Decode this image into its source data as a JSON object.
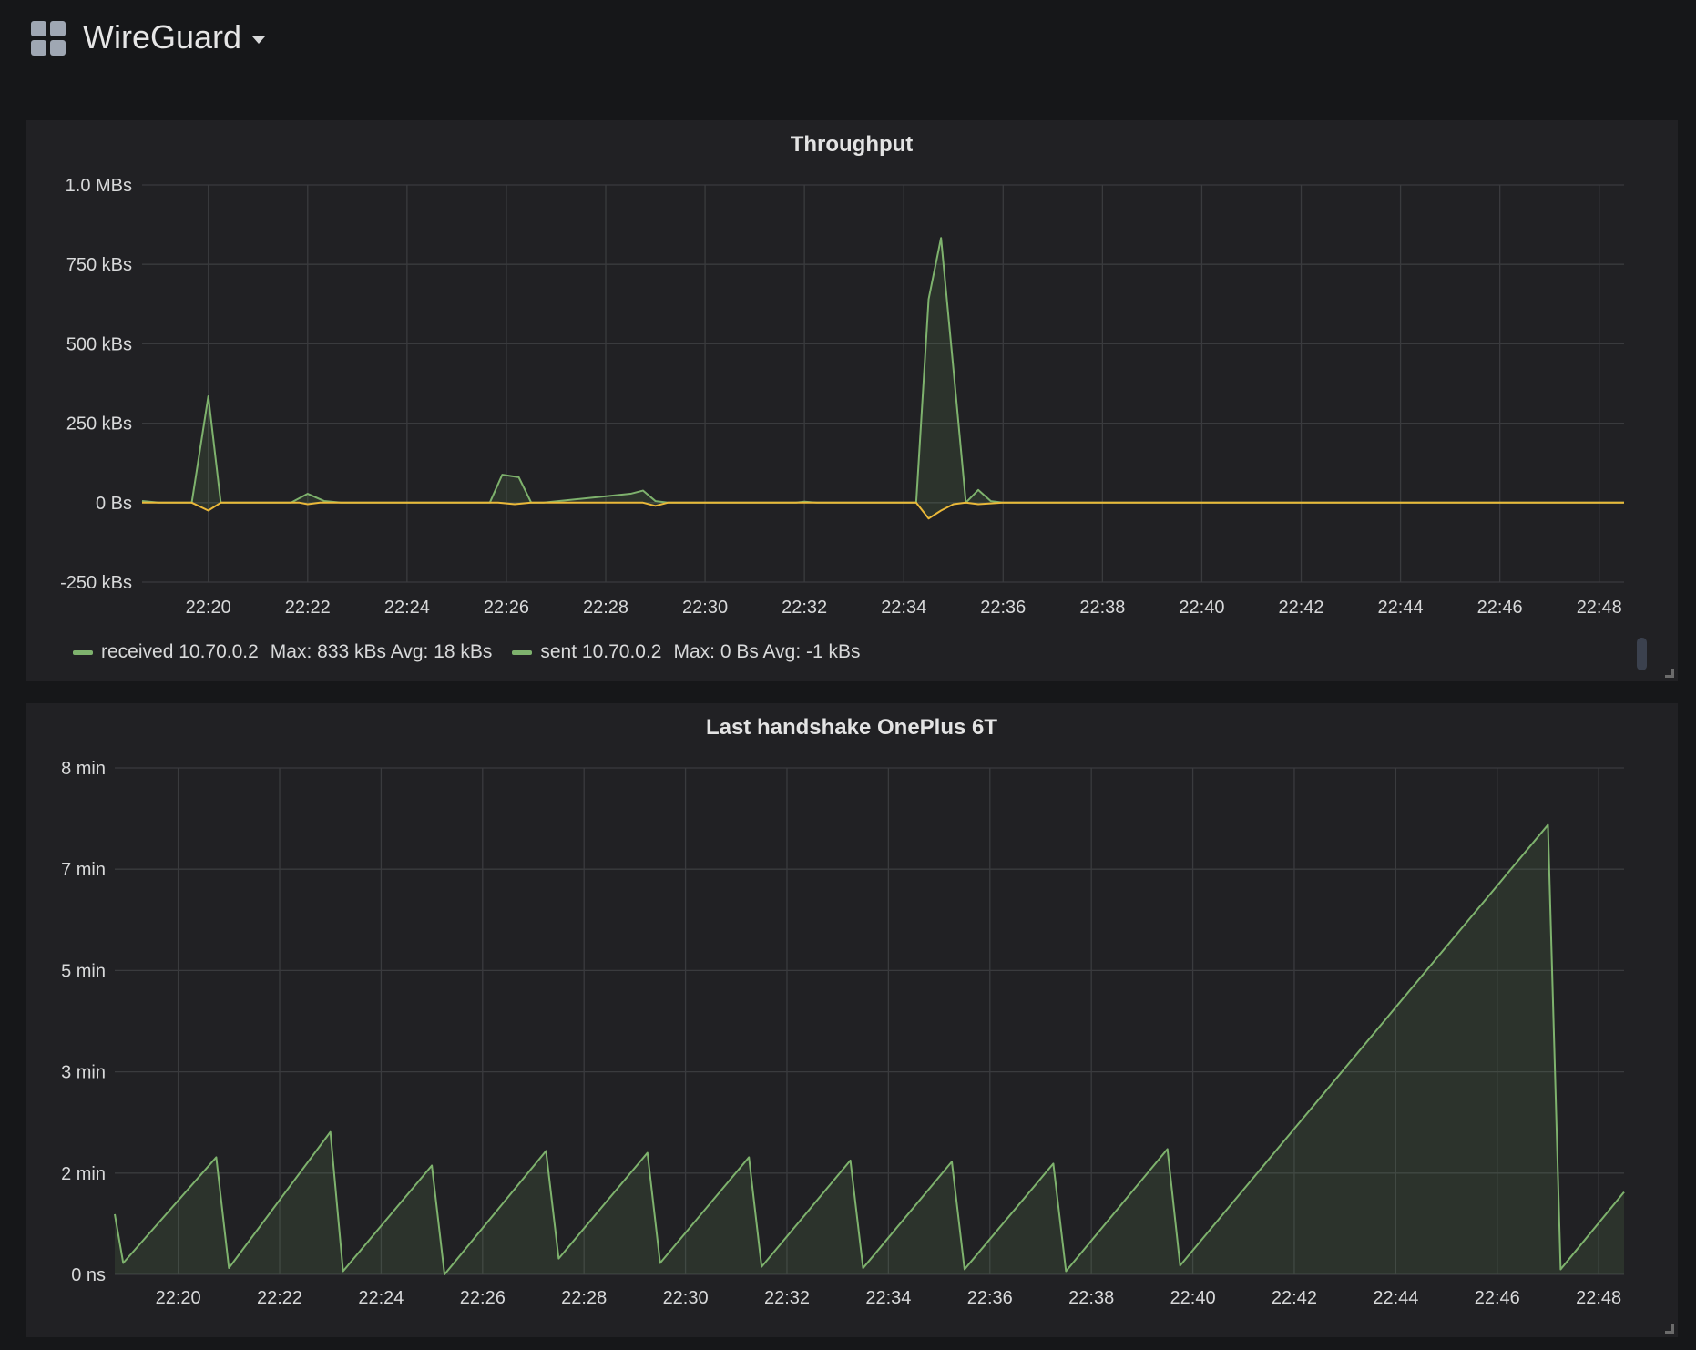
{
  "dashboard": {
    "title": "WireGuard"
  },
  "colors": {
    "received": "#7eb26d",
    "sent": "#eab839",
    "grid": "#3a3b3e",
    "fill": "rgba(126,178,109,0.12)"
  },
  "chart_data": [
    {
      "type": "line",
      "title": "Throughput",
      "x_unit": "time",
      "x_range": [
        "22:18:40",
        "22:48:30"
      ],
      "ylim": [
        -250,
        1000
      ],
      "y_ticks": [
        {
          "value": 1000,
          "label": "1.0 MBs"
        },
        {
          "value": 750,
          "label": "750 kBs"
        },
        {
          "value": 500,
          "label": "500 kBs"
        },
        {
          "value": 250,
          "label": "250 kBs"
        },
        {
          "value": 0,
          "label": "0 Bs"
        },
        {
          "value": -250,
          "label": "-250 kBs"
        }
      ],
      "x_ticks": [
        "22:20",
        "22:22",
        "22:24",
        "22:26",
        "22:28",
        "22:30",
        "22:32",
        "22:34",
        "22:36",
        "22:38",
        "22:40",
        "22:42",
        "22:44",
        "22:46",
        "22:48"
      ],
      "grid": true,
      "series": [
        {
          "name": "received 10.70.0.2",
          "stats": "Max: 833 kBs   Avg: 18 kBs",
          "x": [
            "22:18:40",
            "22:19:00",
            "22:19:40",
            "22:20:00",
            "22:20:15",
            "22:21:40",
            "22:22:00",
            "22:22:20",
            "22:22:40",
            "22:25:40",
            "22:25:55",
            "22:26:15",
            "22:26:30",
            "22:26:45",
            "22:28:30",
            "22:28:45",
            "22:29:00",
            "22:29:15",
            "22:31:50",
            "22:32:00",
            "22:32:15",
            "22:34:15",
            "22:34:30",
            "22:34:45",
            "22:35:00",
            "22:35:15",
            "22:35:30",
            "22:35:45",
            "22:36:00",
            "22:48:30"
          ],
          "values": [
            5,
            0,
            0,
            335,
            0,
            0,
            28,
            5,
            0,
            0,
            88,
            80,
            0,
            0,
            28,
            38,
            5,
            0,
            0,
            3,
            0,
            0,
            640,
            833,
            420,
            0,
            40,
            5,
            0,
            0
          ]
        },
        {
          "name": "sent 10.70.0.2",
          "stats": "Max: 0 Bs   Avg: -1 kBs",
          "x": [
            "22:18:40",
            "22:19:40",
            "22:20:00",
            "22:20:15",
            "22:21:50",
            "22:22:00",
            "22:22:15",
            "22:25:50",
            "22:26:10",
            "22:26:30",
            "22:28:45",
            "22:29:00",
            "22:29:15",
            "22:34:15",
            "22:34:30",
            "22:34:45",
            "22:35:00",
            "22:35:15",
            "22:35:30",
            "22:36:00",
            "22:48:30"
          ],
          "values": [
            0,
            0,
            -25,
            0,
            0,
            -5,
            0,
            0,
            -5,
            0,
            0,
            -10,
            0,
            0,
            -50,
            -25,
            -5,
            0,
            -5,
            0,
            0
          ]
        }
      ],
      "legend": "bottom-left"
    },
    {
      "type": "area",
      "title": "Last handshake OnePlus 6T",
      "x_unit": "time",
      "x_range": [
        "22:18:45",
        "22:48:30"
      ],
      "ylim": [
        0,
        8
      ],
      "y_ticks": [
        {
          "value": 8,
          "label": "8 min"
        },
        {
          "value": 6.4,
          "label": "7 min"
        },
        {
          "value": 4.8,
          "label": "5 min"
        },
        {
          "value": 3.2,
          "label": "3 min"
        },
        {
          "value": 1.6,
          "label": "2 min"
        },
        {
          "value": 0,
          "label": "0 ns"
        }
      ],
      "x_ticks": [
        "22:20",
        "22:22",
        "22:24",
        "22:26",
        "22:28",
        "22:30",
        "22:32",
        "22:34",
        "22:36",
        "22:38",
        "22:40",
        "22:42",
        "22:44",
        "22:46",
        "22:48"
      ],
      "grid": true,
      "series": [
        {
          "name": "",
          "x": [
            "22:18:45",
            "22:18:55",
            "22:20:45",
            "22:21:00",
            "22:23:00",
            "22:23:15",
            "22:25:00",
            "22:25:15",
            "22:27:15",
            "22:27:30",
            "22:29:15",
            "22:29:30",
            "22:31:15",
            "22:31:30",
            "22:33:15",
            "22:33:30",
            "22:35:15",
            "22:35:30",
            "22:37:15",
            "22:37:30",
            "22:39:30",
            "22:39:45",
            "22:47:00",
            "22:47:15",
            "22:48:30"
          ],
          "values": [
            0.95,
            0.18,
            1.85,
            0.1,
            2.25,
            0.05,
            1.72,
            0.0,
            1.95,
            0.25,
            1.92,
            0.18,
            1.85,
            0.12,
            1.8,
            0.1,
            1.78,
            0.08,
            1.75,
            0.05,
            1.98,
            0.14,
            7.1,
            0.08,
            1.3
          ]
        }
      ]
    }
  ]
}
